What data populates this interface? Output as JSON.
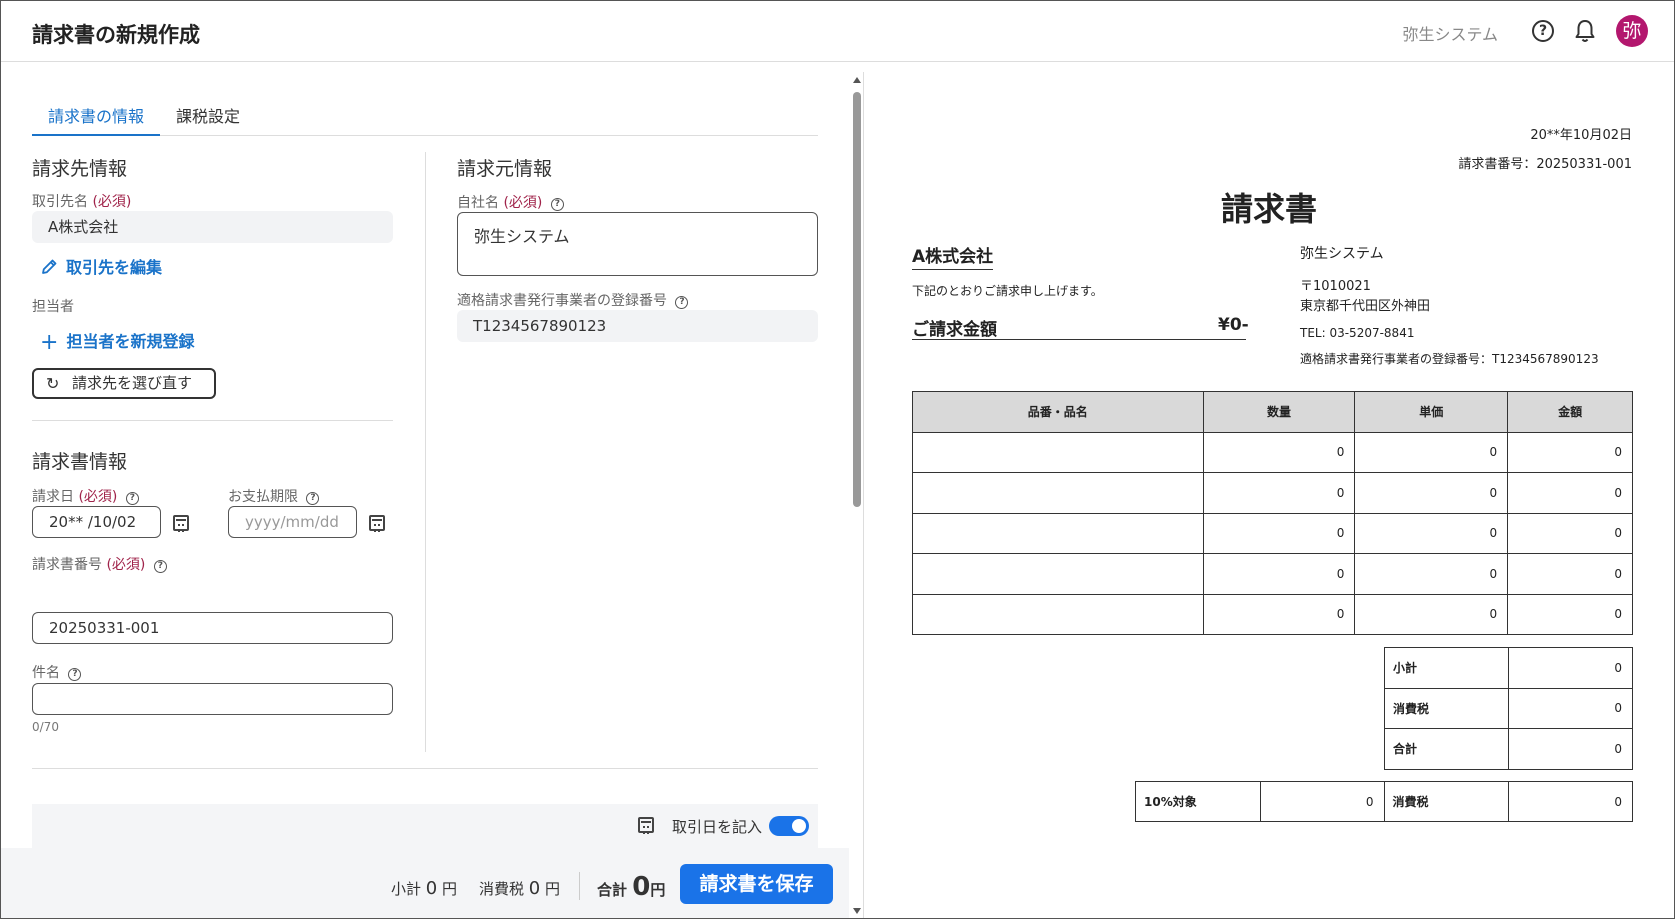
{
  "header": {
    "title": "請求書の新規作成",
    "company": "弥生システム",
    "avatar_letter": "弥"
  },
  "tabs": [
    {
      "label": "請求書の情報",
      "active": true
    },
    {
      "label": "課税設定",
      "active": false
    }
  ],
  "bill_to": {
    "section_title": "請求先情報",
    "client_label": "取引先名",
    "required_mark": "(必須)",
    "client_value": "A株式会社",
    "edit_client_link": "取引先を編集",
    "person_label": "担当者",
    "add_person_link": "担当者を新規登録",
    "reselect_button": "請求先を選び直す"
  },
  "bill_from": {
    "section_title": "請求元情報",
    "own_name_label": "自社名",
    "own_name_value": "弥生システム",
    "registration_label": "適格請求書発行事業者の登録番号",
    "registration_value": "T1234567890123"
  },
  "invoice_info": {
    "section_title": "請求書情報",
    "invoice_date_label": "請求日",
    "invoice_date_value": "20** /10/02",
    "due_date_label": "お支払期限",
    "due_date_placeholder": "yyyy/mm/dd",
    "invoice_number_label": "請求書番号",
    "invoice_number_value": "20250331-001",
    "subject_label": "件名",
    "subject_value": "",
    "subject_counter": "0/70"
  },
  "lines_toolbar": {
    "transaction_date_label": "取引日を記入",
    "transaction_date_on": true
  },
  "footer": {
    "subtotal_label": "小計",
    "subtotal_value": "0",
    "tax_label": "消費税",
    "tax_value": "0",
    "total_label": "合計",
    "total_value": "0",
    "currency_unit": "円",
    "save_button": "請求書を保存"
  },
  "preview": {
    "date": "20**年10月02日",
    "number": "請求書番号：20250331-001",
    "title": "請求書",
    "client": "A株式会社",
    "message": "下記のとおりご請求申し上げます。",
    "amount_label": "ご請求金額",
    "amount_value": "¥0-",
    "from_name": "弥生システム",
    "postal": "〒1010021",
    "address": "東京都千代田区外神田",
    "tel": "TEL: 03-5207-8841",
    "registration": "適格請求書発行事業者の登録番号：T1234567890123",
    "table_headers": [
      "品番・品名",
      "数量",
      "単価",
      "金額"
    ],
    "rows": [
      [
        "",
        "0",
        "0",
        "0"
      ],
      [
        "",
        "0",
        "0",
        "0"
      ],
      [
        "",
        "0",
        "0",
        "0"
      ],
      [
        "",
        "0",
        "0",
        "0"
      ],
      [
        "",
        "0",
        "0",
        "0"
      ]
    ],
    "totals": [
      {
        "label": "小計",
        "value": "0"
      },
      {
        "label": "消費税",
        "value": "0"
      },
      {
        "label": "合計",
        "value": "0"
      }
    ],
    "tax_breakdown": {
      "rate_label": "10%対象",
      "rate_value": "0",
      "tax_label": "消費税",
      "tax_value": "0"
    }
  },
  "colors": {
    "accent": "#1a73e8",
    "link": "#1a73c9",
    "required": "#a0234a",
    "avatar": "#b3176e"
  }
}
